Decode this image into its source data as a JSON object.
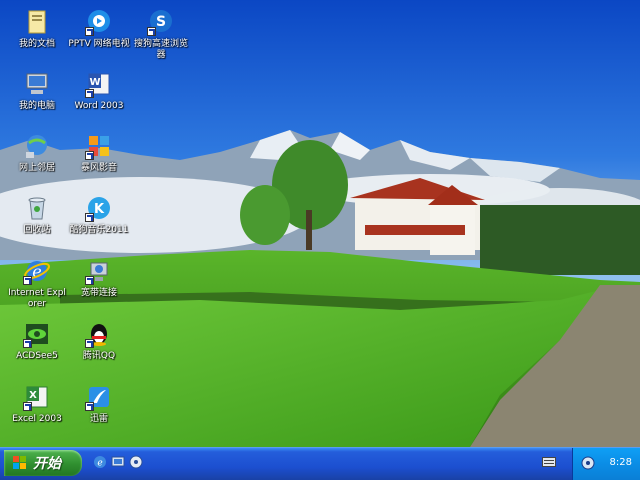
{
  "desktop": {
    "icons": [
      {
        "label": "我的文档",
        "icon": "my-documents-icon"
      },
      {
        "label": "PPTV 网络电视",
        "icon": "pptv-icon"
      },
      {
        "label": "搜狗高速浏览器",
        "icon": "sogou-browser-icon"
      },
      {
        "label": "我的电脑",
        "icon": "my-computer-icon"
      },
      {
        "label": "Word 2003",
        "icon": "word-icon"
      },
      {
        "label": "网上邻居",
        "icon": "network-places-icon"
      },
      {
        "label": "暴风影音",
        "icon": "baofeng-icon"
      },
      {
        "label": "回收站",
        "icon": "recycle-bin-icon"
      },
      {
        "label": "酷狗音乐2011",
        "icon": "kugou-icon"
      },
      {
        "label": "Internet Explorer",
        "icon": "ie-icon"
      },
      {
        "label": "宽带连接",
        "icon": "broadband-icon"
      },
      {
        "label": "ACDSee5",
        "icon": "acdsee-icon"
      },
      {
        "label": "腾讯QQ",
        "icon": "qq-icon"
      },
      {
        "label": "Excel 2003",
        "icon": "excel-icon"
      },
      {
        "label": "迅雷",
        "icon": "thunder-icon"
      }
    ]
  },
  "taskbar": {
    "start_label": "开始",
    "quick_launch": [
      "ie-quicklaunch-icon",
      "show-desktop-icon",
      "media-quicklaunch-icon"
    ],
    "tray": {
      "clock": "8:28",
      "icons": [
        "keyboard-icon",
        "volume-icon"
      ]
    }
  },
  "colors": {
    "taskbar": "#245edb",
    "start_button": "#3c9c3c",
    "tray": "#0b8de6",
    "sky": "#1d5fd0",
    "grass": "#3f9a1e"
  }
}
